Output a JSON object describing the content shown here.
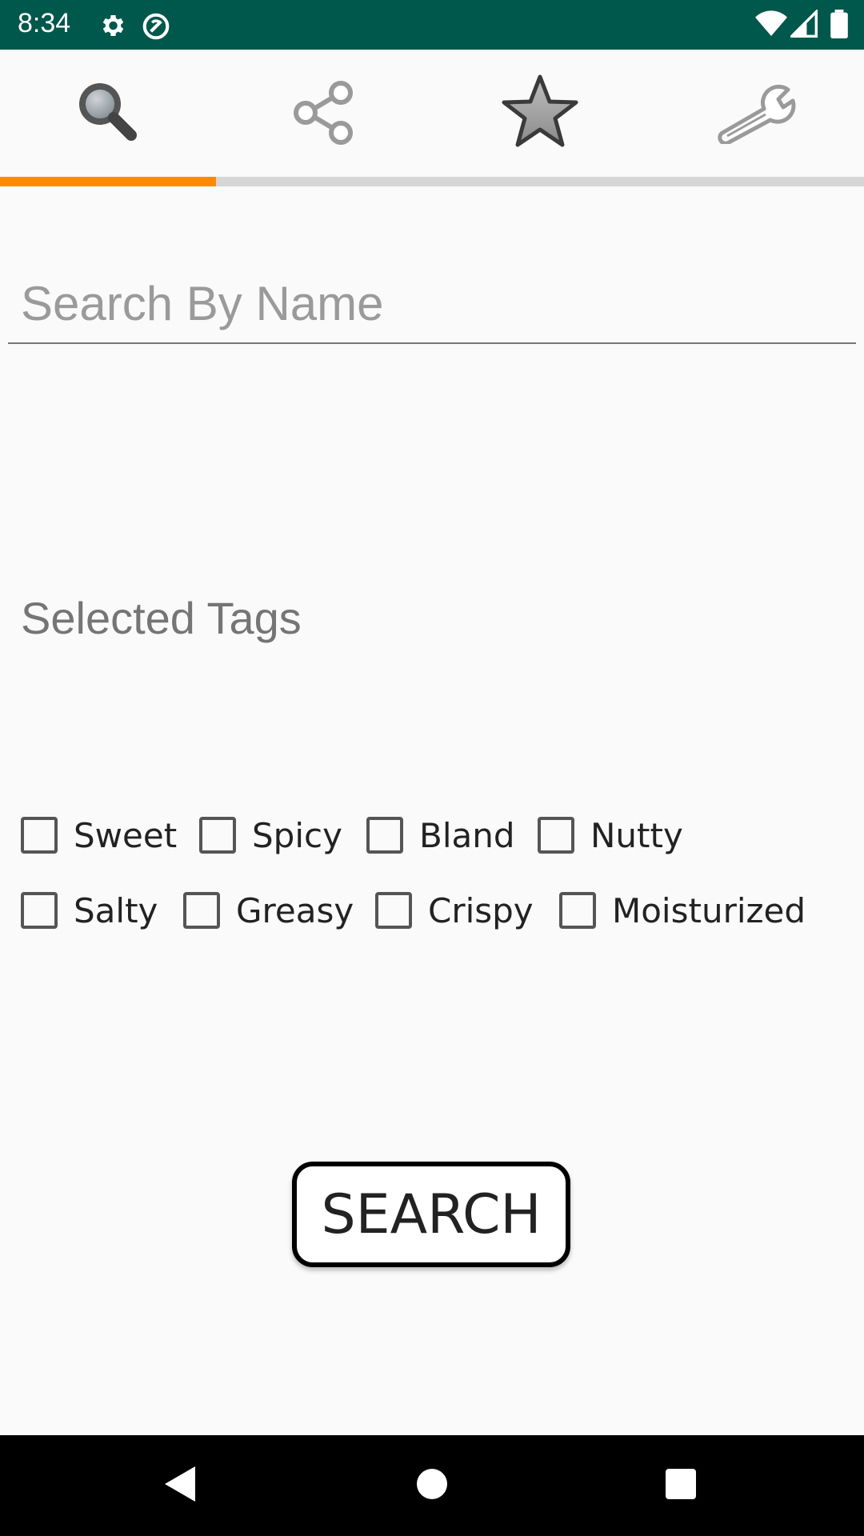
{
  "status_bar": {
    "time": "8:34",
    "icons": [
      "settings-icon",
      "vpn-icon",
      "wifi-icon",
      "signal-icon",
      "battery-icon"
    ],
    "background": "#00574b"
  },
  "tabs": [
    {
      "name": "search",
      "icon": "search-icon",
      "selected": true
    },
    {
      "name": "share",
      "icon": "share-icon",
      "selected": false
    },
    {
      "name": "favorites",
      "icon": "star-icon",
      "selected": false
    },
    {
      "name": "settings",
      "icon": "wrench-icon",
      "selected": false
    }
  ],
  "tab_indicator_color": "#ff8a00",
  "search": {
    "placeholder": "Search By Name",
    "value": ""
  },
  "selected_tags_label": "Selected Tags",
  "tags_row1": [
    "Sweet",
    "Spicy",
    "Bland",
    "Nutty"
  ],
  "tags_row2": [
    "Salty",
    "Greasy",
    "Crispy",
    "Moisturized"
  ],
  "search_button_label": "SEARCH",
  "nav_bar": {
    "buttons": [
      "back-icon",
      "home-icon",
      "recents-icon"
    ]
  }
}
